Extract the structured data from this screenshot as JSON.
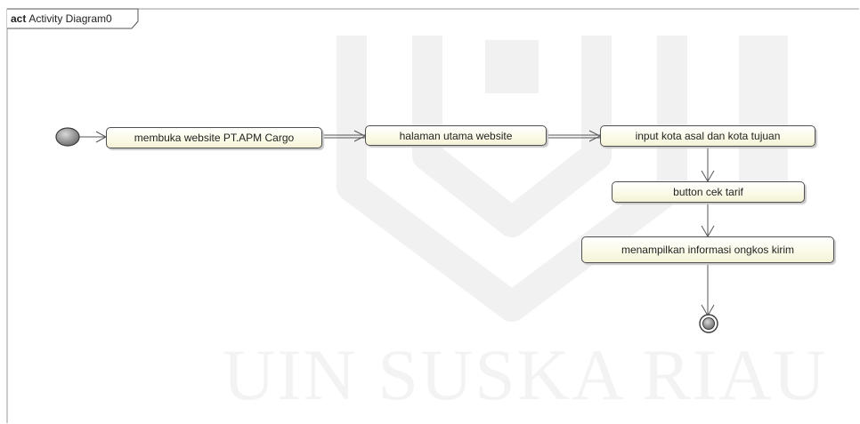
{
  "frame": {
    "keyword": "act",
    "title": "Activity Diagram0"
  },
  "watermark": {
    "text": "UIN SUSKA RIAU"
  },
  "activities": [
    {
      "id": "a1",
      "label": "membuka website PT.APM Cargo"
    },
    {
      "id": "a2",
      "label": "halaman utama website"
    },
    {
      "id": "a3",
      "label": "input kota asal dan kota tujuan"
    },
    {
      "id": "a4",
      "label": "button cek tarif"
    },
    {
      "id": "a5",
      "label": "menampilkan informasi ongkos kirim"
    }
  ],
  "flows": [
    [
      "initial",
      "a1"
    ],
    [
      "a1",
      "a2"
    ],
    [
      "a2",
      "a3"
    ],
    [
      "a3",
      "a4"
    ],
    [
      "a4",
      "a5"
    ],
    [
      "a5",
      "final"
    ]
  ],
  "colors": {
    "node_fill": "#fbfae6",
    "node_border": "#505050",
    "line": "#555555",
    "watermark": "#f3f3f3"
  }
}
